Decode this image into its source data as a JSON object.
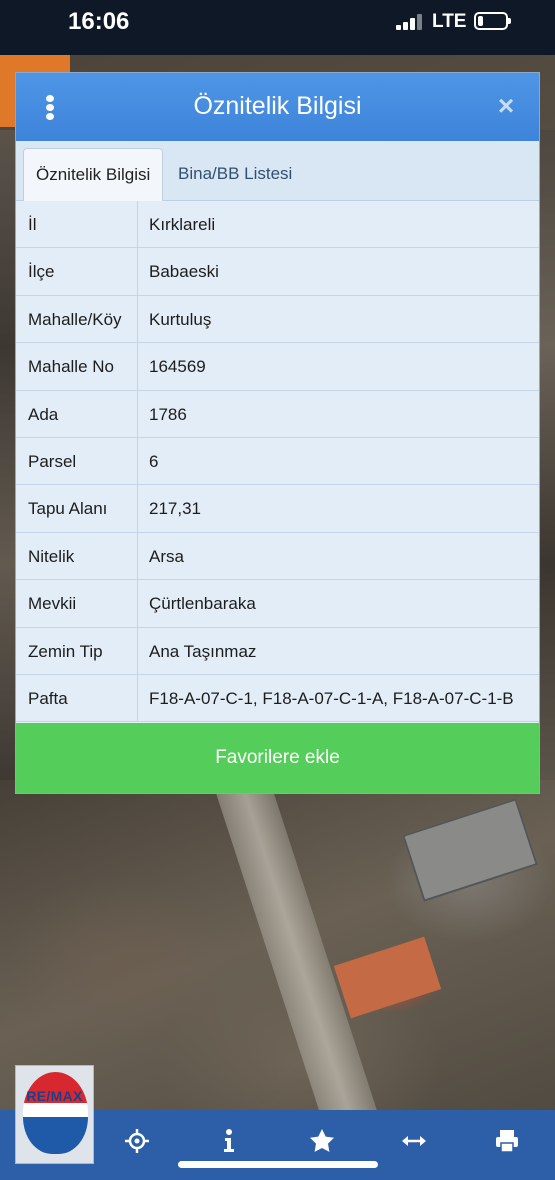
{
  "status_bar": {
    "time": "16:06",
    "network": "LTE",
    "battery_level": 0.2
  },
  "dialog": {
    "title": "Öznitelik Bilgisi",
    "close_label": "×",
    "tabs": [
      {
        "label": "Öznitelik Bilgisi",
        "active": true
      },
      {
        "label": "Bina/BB Listesi",
        "active": false
      }
    ],
    "rows": [
      {
        "key": "İl",
        "value": "Kırklareli"
      },
      {
        "key": "İlçe",
        "value": "Babaeski"
      },
      {
        "key": "Mahalle/Köy",
        "value": "Kurtuluş"
      },
      {
        "key": "Mahalle No",
        "value": "164569"
      },
      {
        "key": "Ada",
        "value": "1786"
      },
      {
        "key": "Parsel",
        "value": "6"
      },
      {
        "key": "Tapu Alanı",
        "value": "217,31"
      },
      {
        "key": "Nitelik",
        "value": "Arsa"
      },
      {
        "key": "Mevkii",
        "value": "Çürtlenbaraka"
      },
      {
        "key": "Zemin Tip",
        "value": "Ana Taşınmaz"
      },
      {
        "key": "Pafta",
        "value": "F18-A-07-C-1, F18-A-07-C-1-A, F18-A-07-C-1-B"
      }
    ],
    "favorite_button": "Favorilere ekle"
  },
  "logo": {
    "brand": "RE/MAX"
  },
  "toolbar": {
    "icons": [
      "refresh-icon",
      "locate-crosshair-icon",
      "info-icon",
      "star-icon",
      "measure-arrows-icon",
      "print-icon"
    ]
  },
  "colors": {
    "header_blue": "#3d84da",
    "favorite_green": "#55cd5b",
    "toolbar_blue": "#2d5fa8"
  }
}
